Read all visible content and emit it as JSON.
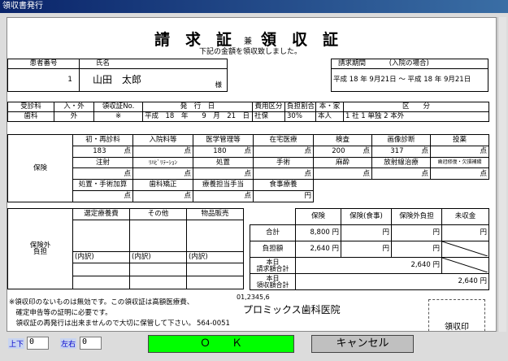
{
  "window": {
    "title": "領収書発行"
  },
  "doc": {
    "heading_main": "請　求　証",
    "heading_ken": "兼",
    "heading_receipt": "領　収　証",
    "subtitle": "下記の金額を領収致しました。",
    "patient": {
      "id_label": "患者番号",
      "name_label": "氏名",
      "id_value": "1",
      "name_value": "山田　太郎",
      "sama": "様"
    },
    "period": {
      "label": "請求期間",
      "note": "(入院の場合)",
      "value": "平成 18 年  9月21日 ～ 平成 18 年  9月21日"
    },
    "info": {
      "headers": [
        "受診科",
        "入・外",
        "領収証No.",
        "発　行　日",
        "費用区分",
        "負担割合",
        "本・家",
        "区　　分"
      ],
      "values": [
        "歯科",
        "外",
        "※",
        "平成　18　年　　9　月　21　日",
        "社保",
        "30%",
        "本人",
        "1 社 1 単独 2 本外"
      ]
    },
    "insurance": {
      "side_label": "保険",
      "row1_headers": [
        "初・再診料",
        "入院料等",
        "医学管理等",
        "在宅医療",
        "検査",
        "画像診断",
        "投薬"
      ],
      "row1_values": [
        "183",
        "",
        "180",
        "",
        "200",
        "317",
        ""
      ],
      "row2_headers": [
        "注射",
        "ﾘﾊﾋﾞﾘﾃｰｼｮﾝ",
        "処置",
        "手術",
        "麻酔",
        "放射線治療",
        "歯冠修復・欠損補綴"
      ],
      "row3_headers": [
        "処置・手術加算",
        "歯科矯正",
        "療養担当手当",
        "食事療養"
      ],
      "unit_ten": "点",
      "unit_yen": "円"
    },
    "outside": {
      "side_label": "保険外\n負担",
      "headers": [
        "選定療養費",
        "その他",
        "物品販売"
      ],
      "breakdown": "(内訳)"
    },
    "summary": {
      "headers": [
        "保険",
        "保険(食事)",
        "保険外負担",
        "未収金"
      ],
      "rows": [
        {
          "label": "合計",
          "values": [
            "8,800",
            "",
            "",
            ""
          ]
        },
        {
          "label": "負担額",
          "values": [
            "2,640",
            "",
            "",
            ""
          ]
        },
        {
          "label": "本日\n請求額合計",
          "value": "2,640"
        },
        {
          "label": "本日\n領収額合計",
          "value": "2,640"
        }
      ],
      "unit_yen": "円"
    },
    "notes": [
      "※領収印のないものは無効です。この領収証は高額医療費、",
      "　確定申告等の証明に必要です。",
      "　領収証の再発行は出来ませんので大切に保管して下さい。"
    ],
    "clinic_code": "01,2345,6",
    "clinic_name": "プロミックス歯科医院",
    "phone": "564-0051",
    "stamp_label": "領収印"
  },
  "controls": {
    "updown_label": "上下",
    "updown_value": "0",
    "leftright_label": "左右",
    "leftright_value": "0",
    "ok_label": "Ｏ　　Ｋ",
    "cancel_label": "キャンセル",
    "ok_color": "#00ff00",
    "cancel_color": "#c0c0c0"
  }
}
